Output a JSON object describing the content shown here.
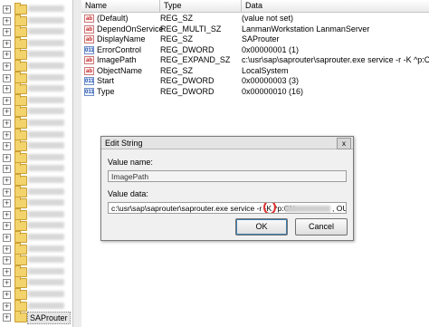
{
  "tree": {
    "selected_label": "SAProuter"
  },
  "list": {
    "columns": [
      "Name",
      "Type",
      "Data"
    ],
    "rows": [
      {
        "icon": "ab",
        "kind": "string",
        "name": "(Default)",
        "type": "REG_SZ",
        "data": "(value not set)"
      },
      {
        "icon": "ab",
        "kind": "string",
        "name": "DependOnService",
        "type": "REG_MULTI_SZ",
        "data": "LanmanWorkstation LanmanServer"
      },
      {
        "icon": "ab",
        "kind": "string",
        "name": "DisplayName",
        "type": "REG_SZ",
        "data": "SAProuter"
      },
      {
        "icon": "011",
        "kind": "dword",
        "name": "ErrorControl",
        "type": "REG_DWORD",
        "data": "0x00000001 (1)"
      },
      {
        "icon": "ab",
        "kind": "string",
        "name": "ImagePath",
        "type": "REG_EXPAND_SZ",
        "data": "c:\\usr\\sap\\saprouter\\saprouter.exe service -r -K ^p:C..."
      },
      {
        "icon": "ab",
        "kind": "string",
        "name": "ObjectName",
        "type": "REG_SZ",
        "data": "LocalSystem"
      },
      {
        "icon": "011",
        "kind": "dword",
        "name": "Start",
        "type": "REG_DWORD",
        "data": "0x00000003 (3)"
      },
      {
        "icon": "011",
        "kind": "dword",
        "name": "Type",
        "type": "REG_DWORD",
        "data": "0x00000010 (16)"
      }
    ]
  },
  "dialog": {
    "title": "Edit String",
    "close_glyph": "x",
    "value_name_label": "Value name:",
    "value_name": "ImagePath",
    "value_data_label": "Value data:",
    "value_data": "c:\\usr\\sap\\saprouter\\saprouter.exe service -r -K ^p:CN=",
    "value_data_tail": ", OU",
    "ok_label": "OK",
    "cancel_label": "Cancel"
  }
}
